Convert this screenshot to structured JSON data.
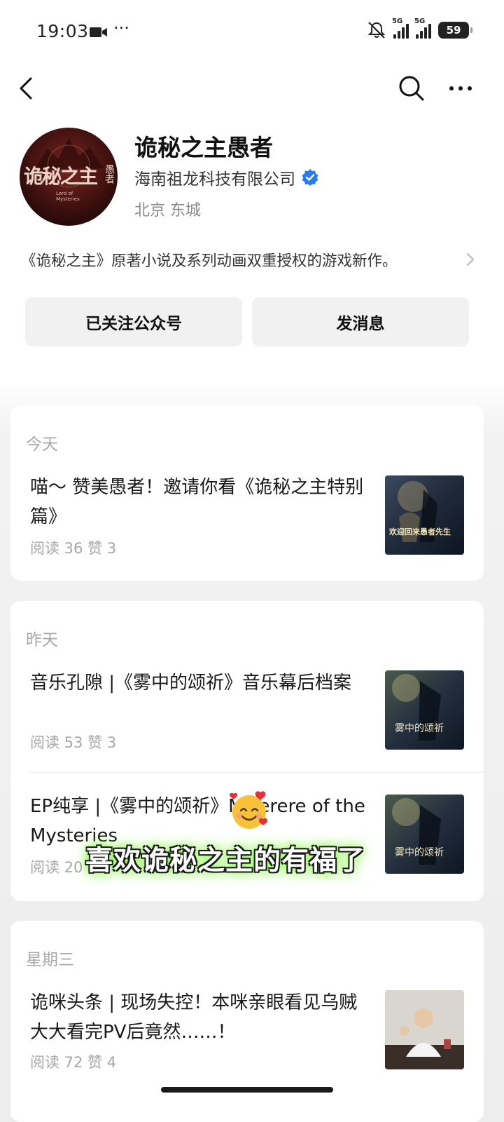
{
  "status_bar": {
    "time": "19:03",
    "network1": "5G",
    "network2": "5G",
    "battery": "59"
  },
  "account": {
    "name": "诡秘之主愚者",
    "company": "海南祖龙科技有限公司",
    "location": "北京 东城",
    "description": "《诡秘之主》原著小说及系列动画双重授权的游戏新作。",
    "avatar_text": "诡秘之主",
    "avatar_sub": "愚者",
    "avatar_en": "Lord of Mysteries"
  },
  "buttons": {
    "follow": "已关注公众号",
    "message": "发消息"
  },
  "articles": {
    "today": {
      "day": "今天",
      "items": [
        {
          "title": "喵～ 赞美愚者！邀请你看《诡秘之主特别篇》",
          "stats": "阅读 36  赞 3",
          "thumb_text": "欢迎回来愚者先生"
        }
      ]
    },
    "yesterday": {
      "day": "昨天",
      "items": [
        {
          "title": "音乐孔隙 |《雾中的颂祈》音乐幕后档案",
          "stats": "阅读 53  赞 3",
          "thumb_text": "雾中的颂祈"
        },
        {
          "title": "EP纯享 |《雾中的颂祈》Miserere of the Mysteries",
          "stats": "阅读 20",
          "thumb_text": "雾中的颂祈"
        }
      ]
    },
    "wednesday": {
      "day": "星期三",
      "items": [
        {
          "title": "诡咪头条 | 现场失控！本咪亲眼看见乌贼大大看完PV后竟然……！",
          "stats": "阅读 72  赞 4"
        }
      ]
    }
  },
  "overlay": {
    "caption": "喜欢诡秘之主的有福了"
  },
  "colors": {
    "verified": "#2b7bf0",
    "card_bg": "#ffffff",
    "button_bg": "#f1f1f1",
    "caption_glow": "#7cff2a"
  }
}
